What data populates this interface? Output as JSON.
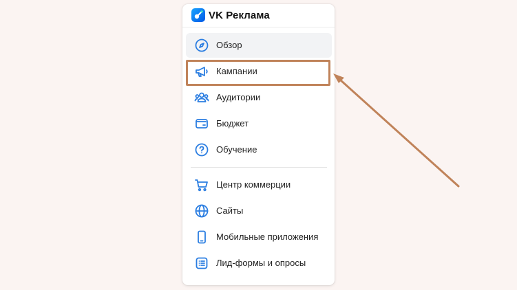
{
  "app": {
    "title": "VK Реклама"
  },
  "colors": {
    "accent": "#2a7de1",
    "highlight": "#c0835a",
    "active_bg": "#f2f3f5"
  },
  "menu": {
    "items": [
      {
        "label": "Обзор",
        "icon": "compass-icon"
      },
      {
        "label": "Кампании",
        "icon": "megaphone-icon"
      },
      {
        "label": "Аудитории",
        "icon": "users-icon"
      },
      {
        "label": "Бюджет",
        "icon": "wallet-icon"
      },
      {
        "label": "Обучение",
        "icon": "question-icon"
      }
    ],
    "secondary_items": [
      {
        "label": "Центр коммерции",
        "icon": "cart-icon"
      },
      {
        "label": "Сайты",
        "icon": "globe-icon"
      },
      {
        "label": "Мобильные приложения",
        "icon": "phone-icon"
      },
      {
        "label": "Лид-формы и опросы",
        "icon": "list-icon"
      }
    ]
  }
}
